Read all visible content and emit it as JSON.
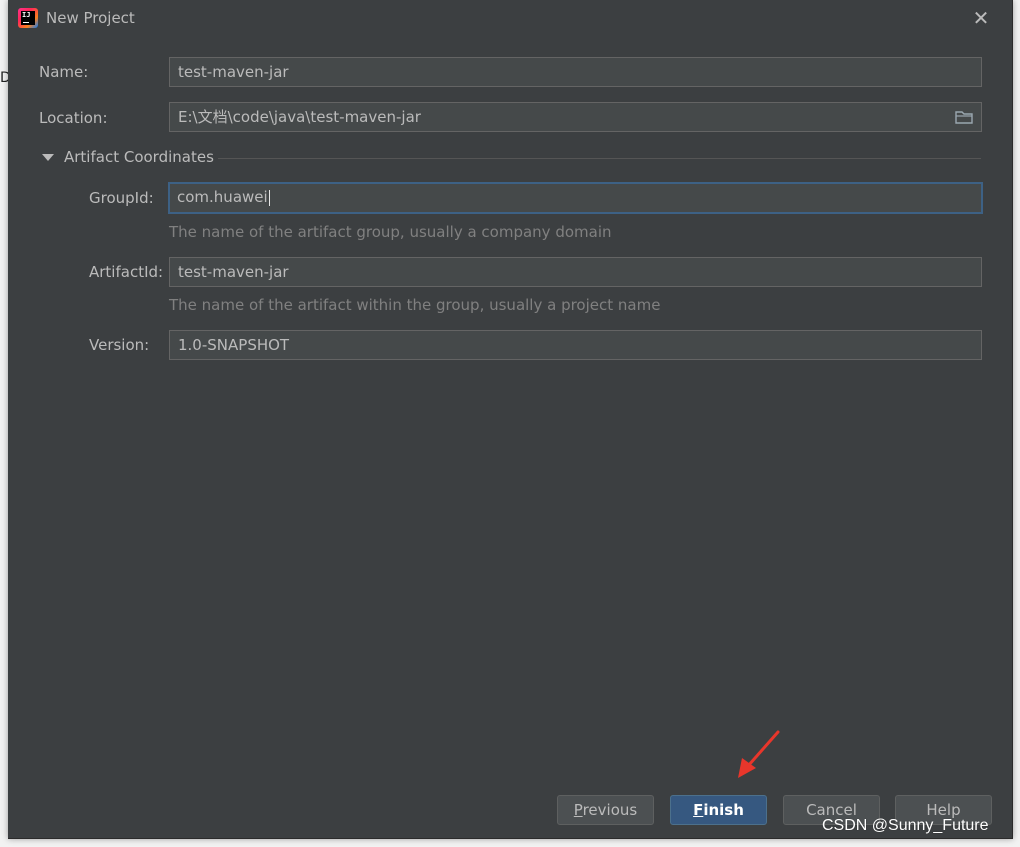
{
  "background": {
    "fragment_text": "Da"
  },
  "dialog": {
    "title": "New Project",
    "icon": "intellij-idea-icon",
    "close_icon": "close-icon"
  },
  "form": {
    "name": {
      "label": "Name:",
      "value": "test-maven-jar"
    },
    "location": {
      "label": "Location:",
      "value": "E:\\文档\\code\\java\\test-maven-jar",
      "browse_icon": "folder-icon"
    },
    "artifact_section": {
      "title": "Artifact Coordinates",
      "expanded": true
    },
    "group_id": {
      "label": "GroupId:",
      "value": "com.huawei",
      "hint": "The name of the artifact group, usually a company domain"
    },
    "artifact_id": {
      "label": "ArtifactId:",
      "value": "test-maven-jar",
      "hint": "The name of the artifact within the group, usually a project name"
    },
    "version": {
      "label": "Version:",
      "value": "1.0-SNAPSHOT"
    }
  },
  "buttons": {
    "previous": {
      "mnemonic": "P",
      "rest": "revious"
    },
    "finish": {
      "mnemonic": "F",
      "rest": "inish"
    },
    "cancel": {
      "label": "Cancel"
    },
    "help": {
      "label": "Help"
    }
  },
  "overlay": {
    "watermark": "CSDN @Sunny_Future",
    "arrow_color": "#e8362b"
  },
  "colors": {
    "dialog_bg": "#3c3f41",
    "field_bg": "#45494a",
    "focus_border": "#3d6185",
    "primary_button": "#365880"
  }
}
